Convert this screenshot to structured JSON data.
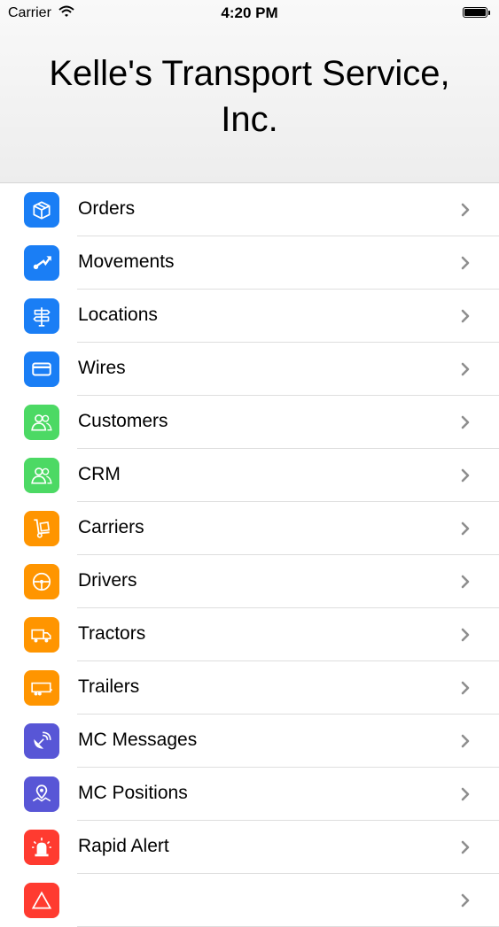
{
  "status_bar": {
    "carrier": "Carrier",
    "time": "4:20 PM"
  },
  "header": {
    "title": "Kelle's Transport Service, Inc."
  },
  "menu": {
    "items": [
      {
        "label": "Orders",
        "icon": "box-icon",
        "color": "#1a7ef5"
      },
      {
        "label": "Movements",
        "icon": "route-arrow-icon",
        "color": "#1a7ef5"
      },
      {
        "label": "Locations",
        "icon": "signpost-icon",
        "color": "#1a7ef5"
      },
      {
        "label": "Wires",
        "icon": "card-icon",
        "color": "#1a7ef5"
      },
      {
        "label": "Customers",
        "icon": "people-icon",
        "color": "#4cd964"
      },
      {
        "label": "CRM",
        "icon": "people-icon",
        "color": "#4cd964"
      },
      {
        "label": "Carriers",
        "icon": "hand-truck-icon",
        "color": "#ff9500"
      },
      {
        "label": "Drivers",
        "icon": "driver-icon",
        "color": "#ff9500"
      },
      {
        "label": "Tractors",
        "icon": "truck-icon",
        "color": "#ff9500"
      },
      {
        "label": "Trailers",
        "icon": "trailer-icon",
        "color": "#ff9500"
      },
      {
        "label": "MC Messages",
        "icon": "satellite-icon",
        "color": "#5856d6"
      },
      {
        "label": "MC Positions",
        "icon": "map-pin-icon",
        "color": "#5856d6"
      },
      {
        "label": "Rapid Alert",
        "icon": "siren-icon",
        "color": "#ff3b30"
      },
      {
        "label": "",
        "icon": "alert-icon",
        "color": "#ff3b30"
      }
    ]
  }
}
